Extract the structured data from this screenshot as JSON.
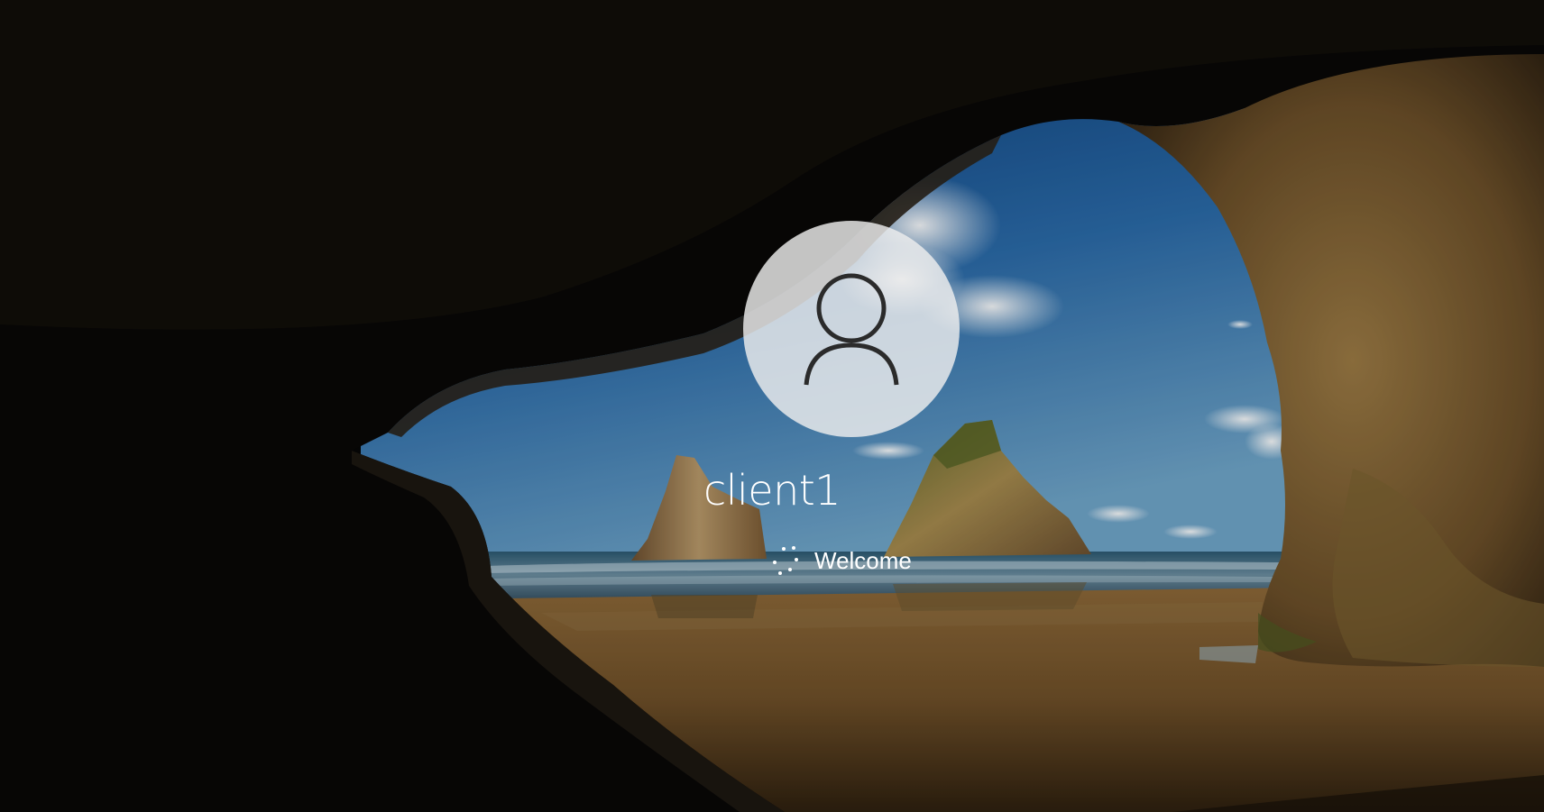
{
  "login": {
    "username": "client1",
    "status": "Welcome"
  },
  "icons": {
    "avatar": "user-silhouette-icon",
    "spinner": "loading-dots-icon"
  },
  "colors": {
    "avatar_bg": "#EEEEEE",
    "avatar_stroke": "#2B2B2B",
    "text": "#FFFFFF"
  }
}
